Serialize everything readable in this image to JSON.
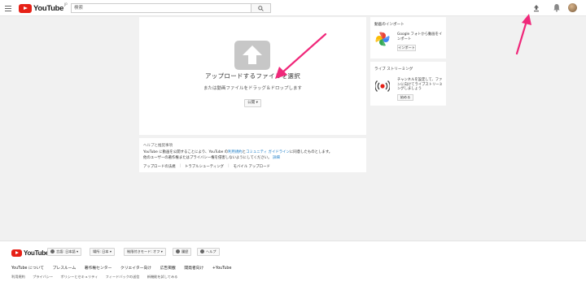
{
  "header": {
    "logo_text": "YouTube",
    "logo_suffix": "JP",
    "search_placeholder": "検索"
  },
  "upload": {
    "title": "アップロードするファイルを選択",
    "subtitle": "または動画ファイルをドラッグ＆ドロップします",
    "privacy_label": "公開 ▾"
  },
  "help": {
    "title": "ヘルプと推奨事項",
    "text_1": "YouTube に動画を公開することにより、YouTube の",
    "link_terms": "利用規約",
    "text_and": "と",
    "link_guidelines": "コミュニティ ガイドライン",
    "text_2": "に同意したものとします。",
    "text_3": "他のユーザーの著作権またはプライバシー権を侵害しないようにしてください。",
    "link_more": "詳細",
    "links": [
      "アップロードの法規",
      "トラブルシューティング",
      "モバイル アップロード"
    ]
  },
  "instant": {
    "title": "動画のインポート",
    "text": "Google フォトから動画をインポート",
    "button": "インポート"
  },
  "live": {
    "title": "ライブ ストリーミング",
    "text": "チャンネルを設定して、ファンに向けてライブストリーミングしましょう",
    "button": "始める"
  },
  "footer": {
    "logo_text": "YouTube",
    "buttons": [
      "言語: 日本語 ▾",
      "場所: 日本 ▾",
      "制限付きモード: オフ ▾",
      "履歴",
      "ヘルプ"
    ],
    "row1": [
      "YouTube について",
      "プレスルーム",
      "著作権センター",
      "クリエイター向け",
      "広告掲載",
      "開発者向け",
      "+YouTube"
    ],
    "row2": [
      "利用規約",
      "プライバシー",
      "ポリシーとセキュリティ",
      "フィードバックの送信",
      "新機能を試してみる"
    ]
  },
  "colors": {
    "brand_red": "#e62117",
    "arrow_pink": "#f0287a",
    "link_blue": "#167ac6",
    "page_bg": "#f1f1f1"
  }
}
